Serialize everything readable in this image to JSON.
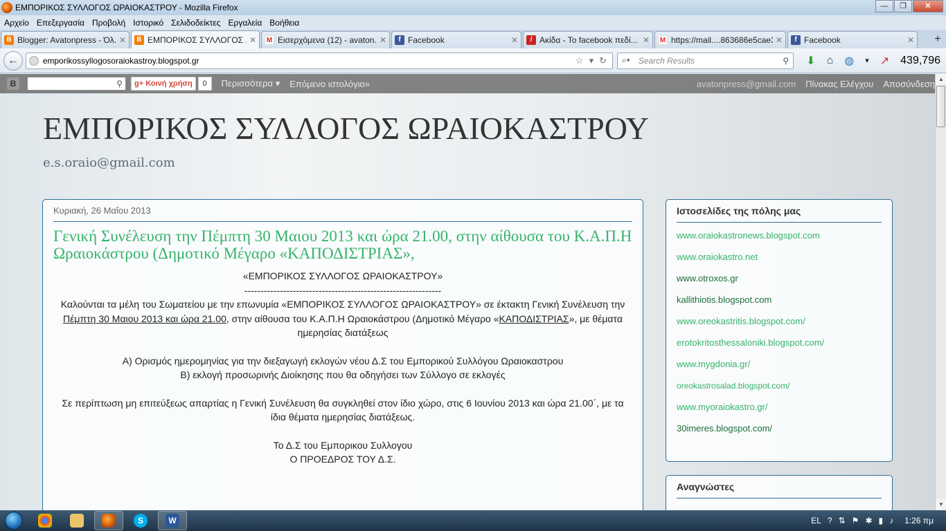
{
  "window": {
    "title": "ΕΜΠΟΡΙΚΟΣ ΣΥΛΛΟΓΟΣ ΩΡΑΙΟΚΑΣΤΡΟΥ - Mozilla Firefox",
    "minimize": "—",
    "maximize": "❐",
    "close": "✕"
  },
  "menu": [
    "Αρχείο",
    "Επεξεργασία",
    "Προβολή",
    "Ιστορικό",
    "Σελιδοδείκτες",
    "Εργαλεία",
    "Βοήθεια"
  ],
  "tabs": [
    {
      "label": "Blogger: Avatonpress - Όλ...",
      "icon": "blogger-icon"
    },
    {
      "label": "ΕΜΠΟΡΙΚΟΣ ΣΥΛΛΟΓΟΣ ...",
      "icon": "blogger-icon",
      "active": true
    },
    {
      "label": "Εισερχόμενα (12) - avaton...",
      "icon": "gmail-icon"
    },
    {
      "label": "Facebook",
      "icon": "facebook-icon"
    },
    {
      "label": "Ακίδα - Το facebook πεδί...",
      "icon": "akida-icon"
    },
    {
      "label": "https://mail....863686e5cae3",
      "icon": "gmail-icon"
    },
    {
      "label": "Facebook",
      "icon": "facebook-icon"
    }
  ],
  "nav": {
    "url": "emporikossyllogosoraiokastroy.blogspot.gr",
    "search_placeholder": "Search Results",
    "counter": "439,796"
  },
  "blogbar": {
    "share": "Κοινή χρήση",
    "share_count": "0",
    "more": "Περισσότερα",
    "next_blog": "Επόμενο ιστολόγιο»",
    "email": "avatonpress@gmail.com",
    "dashboard": "Πίνακας Ελέγχου",
    "signout": "Αποσύνδεση"
  },
  "blog": {
    "title": "ΕΜΠΟΡΙΚΟΣ ΣΥΛΛΟΓΟΣ ΩΡΑΙΟΚΑΣΤΡΟΥ",
    "description": "e.s.oraio@gmail.com"
  },
  "post": {
    "date": "Κυριακή, 26 Μαΐου 2013",
    "title": "Γενική Συνέλευση την Πέμπτη 30 Μαιου 2013 και ώρα 21.00, στην αίθουσα του Κ.Α.Π.Η Ωραιοκάστρου (Δημοτικό Μέγαρο «ΚΑΠΟΔΙΣΤΡΙΑΣ»,",
    "org": "«ΕΜΠΟΡΙΚΟΣ ΣΥΛΛΟΓΟΣ ΩΡΑΙΟΚΑΣΤΡΟΥ»",
    "divider": "-------------------------------------------------------------",
    "p1a": "Καλούνται τα μέλη του Σωματείου με την επωνυμία «ΕΜΠΟΡΙΚΟΣ ΣΥΛΛΟΓΟΣ ΩΡΑΙΟΚΑΣΤΡΟΥ» σε έκτακτη Γενική Συνέλευση την ",
    "p1b": "Πέμπτη 30 Μαιου 2013 και ώρα 21.00",
    "p1c": ", στην αίθουσα του Κ.Α.Π.Η Ωραιοκάστρου (Δημοτικό Μέγαρο «",
    "p1d": "ΚΑΠΟΔΙΣΤΡΙΑΣ",
    "p1e": "», με θέματα ημερησίας διατάξεως",
    "itemA": "Α) Ορισμός ημερομηνίας για την διεξαγωγή εκλογών νέου Δ.Σ του Εμπορικού Συλλόγου Ωραιοκαστρου",
    "itemB": "Β) εκλογή προσωρινής Διοίκησης που θα οδηγήσει των Σύλλογο σε εκλογές",
    "p2": "Σε περίπτωση μη επιτεύξεως απαρτίας η Γενική Συνέλευση θα συγκληθεί στον ίδιο χώρο, στις 6 Ιουνίου 2013 και ώρα 21.00΄, με τα ίδια θέματα ημερησίας διατάξεως.",
    "sign1": "Το Δ.Σ του Εμπορικου Συλλογου",
    "sign2": "Ο ΠΡΟΕΔΡΟΣ ΤΟΥ Δ.Σ."
  },
  "sidebar": {
    "links_title": "Ιστοσελίδες της πόλης μας",
    "links": [
      {
        "text": "www.oraiokastronews.blogspot.com",
        "style": "g"
      },
      {
        "text": "www.oraiokastro.net",
        "style": "g"
      },
      {
        "text": "www.otroxos.gr",
        "style": "d"
      },
      {
        "text": "kallithiotis.blogspot.com",
        "style": "d"
      },
      {
        "text": "www.oreokastritis.blogspot.com/",
        "style": "g"
      },
      {
        "text": "erotokritosthessaloniki.blogspot.com/",
        "style": "g"
      },
      {
        "text": "www.mygdonia.gr/",
        "style": "g"
      },
      {
        "text": "oreokastrosalad.blogspot.com/",
        "style": "g sm"
      },
      {
        "text": "www.myoraiokastro.gr/",
        "style": "g"
      },
      {
        "text": "30imeres.blogspot.com/",
        "style": "d"
      }
    ],
    "readers_title": "Αναγνώστες"
  },
  "taskbar": {
    "lang": "EL",
    "time": "1:26 πμ"
  },
  "colors": {
    "accent": "#36b36a",
    "border": "#2f6f97"
  }
}
